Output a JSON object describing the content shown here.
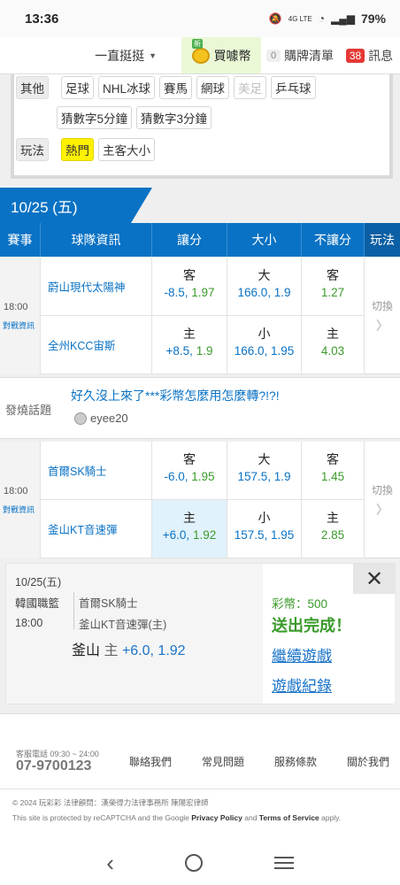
{
  "status_bar": {
    "time": "13:36",
    "network": "4G LTE",
    "battery": "79%"
  },
  "top_nav": {
    "dropdown_label": "一直挺挺",
    "buy_label": "買噱幣",
    "cart_count": "0",
    "cart_label": "購牌清單",
    "msg_count": "38",
    "msg_label": "訊息"
  },
  "filters": {
    "other_label": "其他",
    "sports": [
      "足球",
      "NHL冰球",
      "賽馬",
      "網球",
      "美足",
      "乒乓球"
    ],
    "disabled_sport": "美足",
    "guess": [
      "猜數字5分鐘",
      "猜數字3分鐘"
    ],
    "play_label": "玩法",
    "plays": [
      "熱門",
      "主客大小"
    ]
  },
  "date_header": "10/25 (五)",
  "table_headers": [
    "賽事",
    "球隊資訊",
    "讓分",
    "大小",
    "不讓分",
    "玩法"
  ],
  "matches": [
    {
      "time": "18:00",
      "info_link": "對戰資訊",
      "away_team": "蔚山現代太陽神",
      "home_team": "全州KCC宙斯",
      "away": {
        "spread_label": "客",
        "spread_val": "-8.5,",
        "spread_odds": "1.97",
        "ou_label": "大",
        "ou_val": "166.0,",
        "ou_odds": "1.9",
        "ml_label": "客",
        "ml_odds": "1.27"
      },
      "home": {
        "spread_label": "主",
        "spread_val": "+8.5,",
        "spread_odds": "1.9",
        "ou_label": "小",
        "ou_val": "166.0,",
        "ou_odds": "1.95",
        "ml_label": "主",
        "ml_odds": "4.03"
      },
      "switch_label": "切換"
    },
    {
      "time": "18:00",
      "info_link": "對戰資訊",
      "away_team": "首爾SK騎士",
      "home_team": "釜山KT音速彈",
      "away": {
        "spread_label": "客",
        "spread_val": "-6.0,",
        "spread_odds": "1.95",
        "ou_label": "大",
        "ou_val": "157.5,",
        "ou_odds": "1.9",
        "ml_label": "客",
        "ml_odds": "1.45"
      },
      "home": {
        "spread_label": "主",
        "spread_val": "+6.0,",
        "spread_odds": "1.92",
        "ou_label": "小",
        "ou_val": "157.5,",
        "ou_odds": "1.95",
        "ml_label": "主",
        "ml_odds": "2.85"
      },
      "switch_label": "切換"
    }
  ],
  "hot_topic": {
    "label": "發燒話題",
    "title": "好久沒上來了***彩幣怎麼用怎麼轉?!?!",
    "user": "eyee20"
  },
  "bet_result": {
    "date": "10/25(五)",
    "league": "韓國職籃",
    "time": "18:00",
    "team1": "首爾SK騎士",
    "team2": "釜山KT音速彈(主)",
    "pick_team": "釜山",
    "pick_side": "主",
    "pick_value": "+6.0, 1.92",
    "balance": "彩幣：500",
    "status": "送出完成！",
    "continue_link": "繼續遊戲",
    "history_link": "遊戲紀錄",
    "close": "✕"
  },
  "footer": {
    "phone_label": "客服電話 09:30 ~ 24:00",
    "phone": "07-9700123",
    "links": [
      "聯絡我們",
      "常見問題",
      "服務條款",
      "關於我們"
    ],
    "copyright": "© 2024 玩彩彩  法律顧問：漢榮得力法律事務所 陳陽宏律師",
    "recaptcha_pre": "This site is protected by reCAPTCHA and the Google ",
    "privacy": "Privacy Policy",
    "and": " and ",
    "terms": "Terms of Service",
    "apply": " apply."
  },
  "colors": {
    "accent": "#0a72c4",
    "green": "#3a9a2a",
    "hot": "#fff200",
    "badge_red": "#e53935"
  }
}
